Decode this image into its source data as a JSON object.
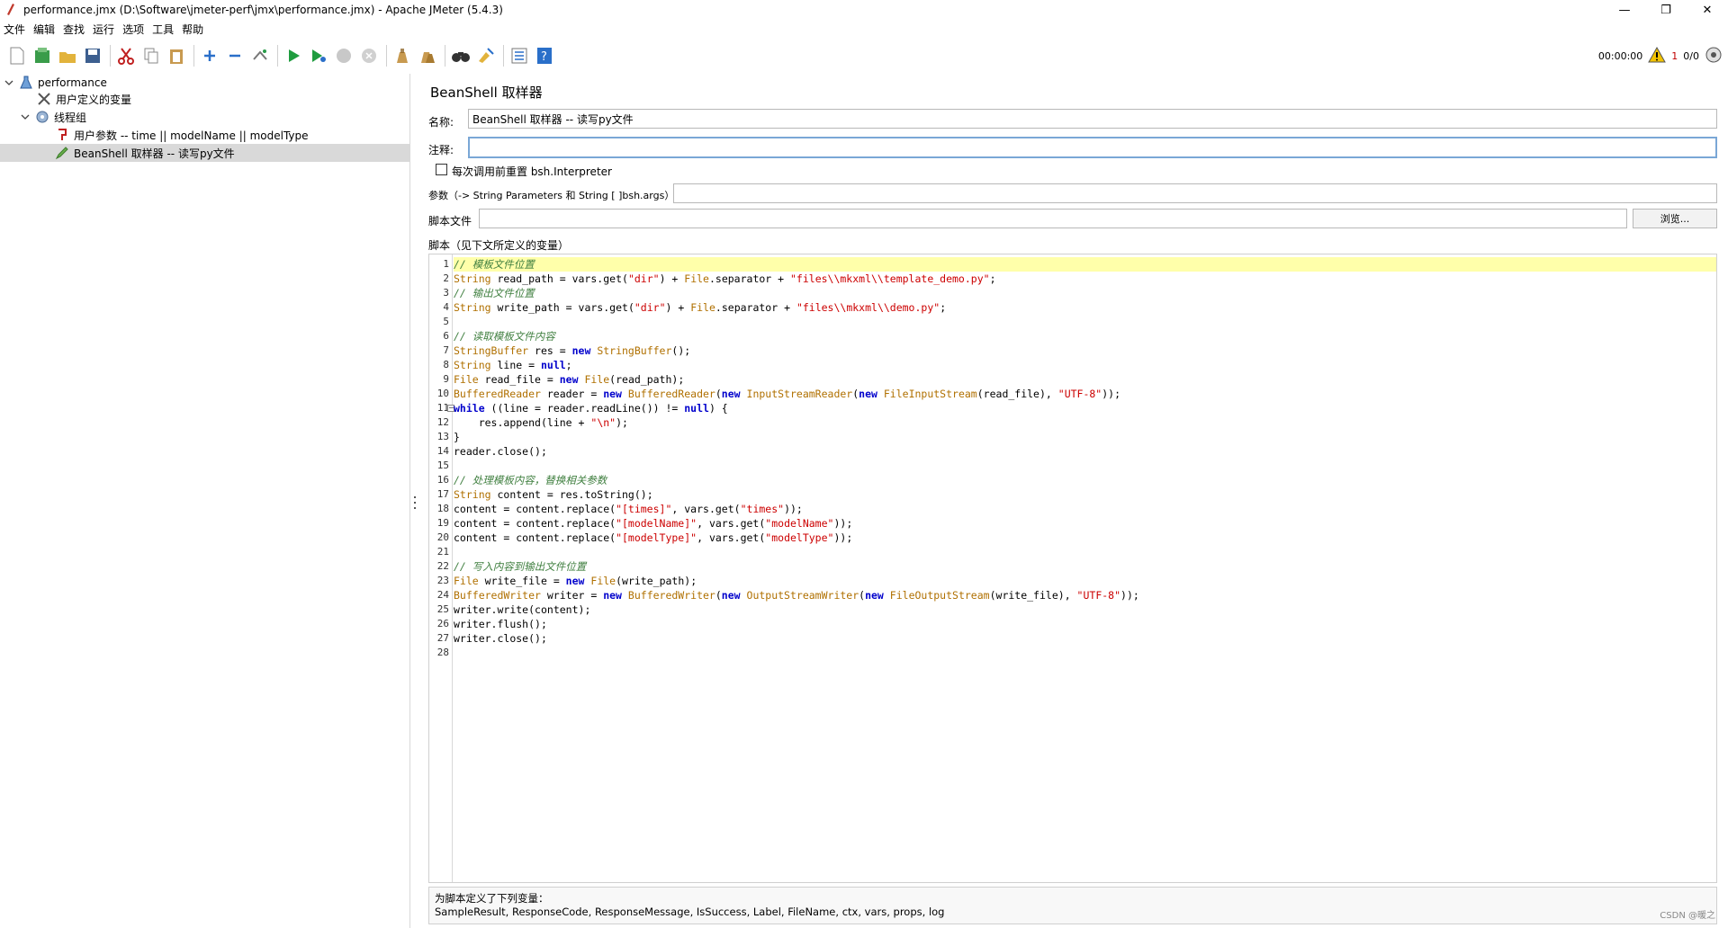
{
  "window": {
    "title": "performance.jmx (D:\\Software\\jmeter-perf\\jmx\\performance.jmx) - Apache JMeter (5.4.3)",
    "minimize": "—",
    "restore": "❐",
    "close": "✕"
  },
  "menu": [
    "文件",
    "编辑",
    "查找",
    "运行",
    "选项",
    "工具",
    "帮助"
  ],
  "status": {
    "timer": "00:00:00",
    "warnings": "1",
    "threads": "0/0"
  },
  "tree": {
    "root": "performance",
    "user_vars": "用户定义的变量",
    "thread_group": "线程组",
    "user_params": "用户参数 -- time || modelName || modelType",
    "beanshell": "BeanShell 取样器 -- 读写py文件"
  },
  "panel": {
    "title": "BeanShell 取样器",
    "name_label": "名称:",
    "name_value": "BeanShell 取样器 -- 读写py文件",
    "comment_label": "注释:",
    "comment_value": "",
    "reset_label": "每次调用前重置 bsh.Interpreter",
    "params_label": "参数（-> String Parameters 和 String [ ]bsh.args）",
    "params_value": "",
    "script_file_label": "脚本文件",
    "script_file_value": "",
    "browse": "浏览...",
    "script_label": "脚本（见下文所定义的变量）"
  },
  "code_lines": [
    "// 模板文件位置",
    "String read_path = vars.get(\"dir\") + File.separator + \"files\\\\mkxml\\\\template_demo.py\";",
    "// 输出文件位置",
    "String write_path = vars.get(\"dir\") + File.separator + \"files\\\\mkxml\\\\demo.py\";",
    "",
    "// 读取模板文件内容",
    "StringBuffer res = new StringBuffer();",
    "String line = null;",
    "File read_file = new File(read_path);",
    "BufferedReader reader = new BufferedReader(new InputStreamReader(new FileInputStream(read_file), \"UTF-8\"));",
    "while ((line = reader.readLine()) != null) {",
    "    res.append(line + \"\\n\");",
    "}",
    "reader.close();",
    "",
    "// 处理模板内容，替换相关参数",
    "String content = res.toString();",
    "content = content.replace(\"[times]\", vars.get(\"times\"));",
    "content = content.replace(\"[modelName]\", vars.get(\"modelName\"));",
    "content = content.replace(\"[modelType]\", vars.get(\"modelType\"));",
    "",
    "// 写入内容到输出文件位置",
    "File write_file = new File(write_path);",
    "BufferedWriter writer = new BufferedWriter(new OutputStreamWriter(new FileOutputStream(write_file), \"UTF-8\"));",
    "writer.write(content);",
    "writer.flush();",
    "writer.close();",
    ""
  ],
  "vars_info": {
    "title": "为脚本定义了下列变量：",
    "list": "SampleResult, ResponseCode, ResponseMessage, IsSuccess, Label, FileName, ctx, vars, props, log"
  },
  "watermark": "CSDN @暖之"
}
